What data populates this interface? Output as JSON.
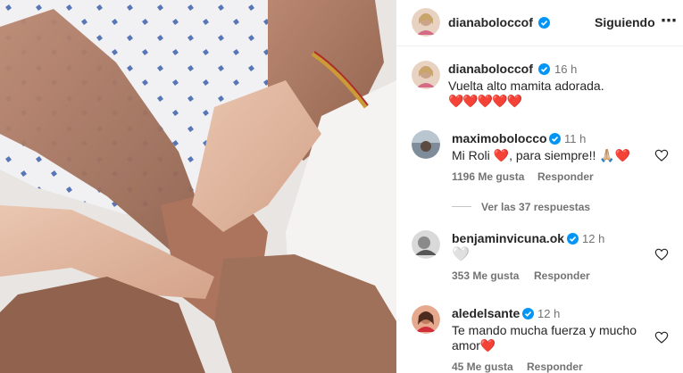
{
  "post": {
    "author": "dianaboloccof",
    "follow_label": "Siguiendo",
    "more_icon": "⋯"
  },
  "caption": {
    "author": "dianaboloccof",
    "time": "16 h",
    "text": "Vuelta alto mamita adorada.",
    "emoji": "❤️❤️❤️❤️❤️"
  },
  "comments": [
    {
      "author": "maximobolocco",
      "time": "11 h",
      "text": "Mi Roli ❤️, para siempre!! 🙏🏼❤️",
      "likes": "1196 Me gusta",
      "reply": "Responder",
      "replies_link": "Ver las 37 respuestas"
    },
    {
      "author": "benjaminvicuna.ok",
      "time": "12 h",
      "text": "🤍",
      "likes": "353 Me gusta",
      "reply": "Responder"
    },
    {
      "author": "aledelsante",
      "time": "12 h",
      "text_line1": "Te mando mucha fuerza y mucho",
      "text_line2": "amor❤️",
      "likes": "45 Me gusta",
      "reply": "Responder"
    }
  ],
  "colors": {
    "verified": "#0095f6",
    "heart": "#ed4956",
    "muted": "#737373"
  }
}
